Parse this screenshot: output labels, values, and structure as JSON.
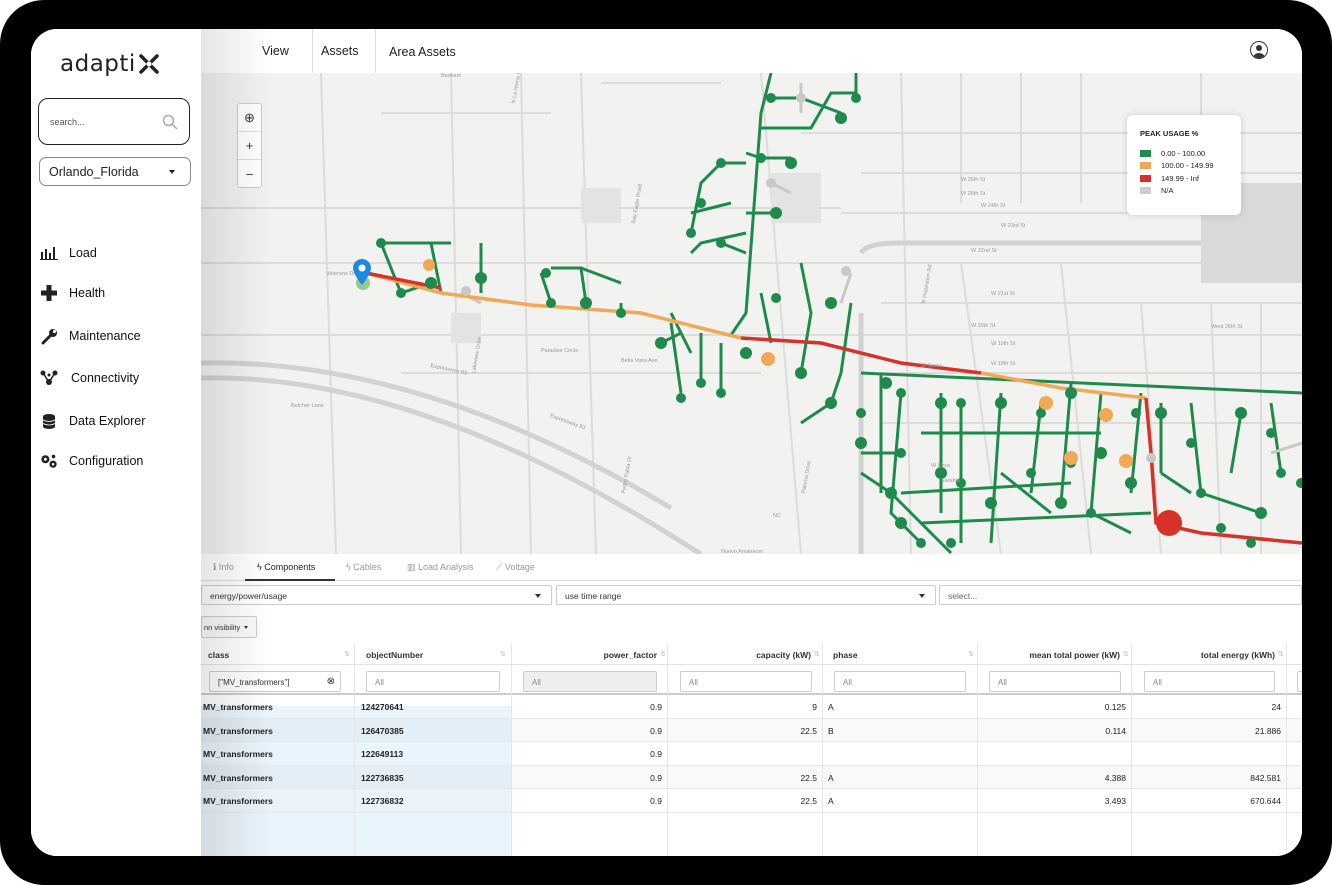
{
  "app": {
    "logo": "adapti"
  },
  "sidebar": {
    "search_placeholder": "search...",
    "city": "Orlando_Florida",
    "items": [
      {
        "label": "Load",
        "icon": "bar-chart-icon"
      },
      {
        "label": "Health",
        "icon": "plus-icon"
      },
      {
        "label": "Maintenance",
        "icon": "wrench-icon"
      },
      {
        "label": "Connectivity",
        "icon": "network-icon"
      },
      {
        "label": "Data Explorer",
        "icon": "database-icon"
      },
      {
        "label": "Configuration",
        "icon": "gears-icon"
      }
    ]
  },
  "topbar": {
    "view": "View",
    "assets": "Assets",
    "area_assets": "Area Assets"
  },
  "map": {
    "zoom_controls": {
      "locate": "⊕",
      "zoom_in": "+",
      "zoom_out": "−"
    },
    "legend": {
      "title": "PEAK USAGE %",
      "items": [
        {
          "label": "0.00 - 100.00",
          "color": "#1e8a4c"
        },
        {
          "label": "100.00 - 149.99",
          "color": "#f2a957"
        },
        {
          "label": "149.99 - Inf",
          "color": "#d7322a"
        },
        {
          "label": "N/A",
          "color": "#cccccc"
        }
      ]
    },
    "street_labels": [
      "Expressway 83",
      "Expressway 83",
      "Veterans Drive",
      "Lakeview Drive",
      "Butcher Lane",
      "Paradise Circle",
      "Bella Vista Ave",
      "W 25th St",
      "W 26th St",
      "W 24th St",
      "W 23rd St",
      "W 22nd St",
      "W 21st St",
      "W 20th St",
      "W 19th St",
      "W 18th St",
      "W Gross",
      "Basham",
      "N La Homa Rd",
      "Bay Eagle Road",
      "N Inspiration Rd",
      "West 26th St",
      "Nuevo Amanecer",
      "NC",
      "Sarabia",
      "W Ezza",
      "Pedro Pabla Dr",
      "Paloma Drive"
    ]
  },
  "panel": {
    "tabs": [
      {
        "label": "Info",
        "icon": "info-icon"
      },
      {
        "label": "Components",
        "icon": "bolt-icon"
      },
      {
        "label": "Cables",
        "icon": "bolt-icon"
      },
      {
        "label": "Load Analysis",
        "icon": "bar-chart-icon"
      },
      {
        "label": "Voltage",
        "icon": "line-chart-icon"
      }
    ],
    "metric_select": "energy/power/usage",
    "time_select": "use time range",
    "third_select": "select...",
    "visibility_button": "nn visibility",
    "columns": [
      "class",
      "objectNumber",
      "power_factor",
      "capacity (kW)",
      "phase",
      "mean total power (kW)",
      "total energy (kWh)"
    ],
    "filters": {
      "class": "[\"MV_transformers\"]",
      "placeholder": "All"
    },
    "rows": [
      {
        "class": "MV_transformers",
        "objectNumber": "124270641",
        "power_factor": "0.9",
        "capacity": "9",
        "phase": "A",
        "mean_power": "0.125",
        "total_energy": "24"
      },
      {
        "class": "MV_transformers",
        "objectNumber": "126470385",
        "power_factor": "0.9",
        "capacity": "22.5",
        "phase": "B",
        "mean_power": "0.114",
        "total_energy": "21.886"
      },
      {
        "class": "MV_transformers",
        "objectNumber": "122649113",
        "power_factor": "0.9",
        "capacity": "",
        "phase": "",
        "mean_power": "",
        "total_energy": ""
      },
      {
        "class": "MV_transformers",
        "objectNumber": "122736835",
        "power_factor": "0.9",
        "capacity": "22.5",
        "phase": "A",
        "mean_power": "4.388",
        "total_energy": "842.581"
      },
      {
        "class": "MV_transformers",
        "objectNumber": "122736832",
        "power_factor": "0.9",
        "capacity": "22.5",
        "phase": "A",
        "mean_power": "3.493",
        "total_energy": "670.644"
      }
    ]
  }
}
